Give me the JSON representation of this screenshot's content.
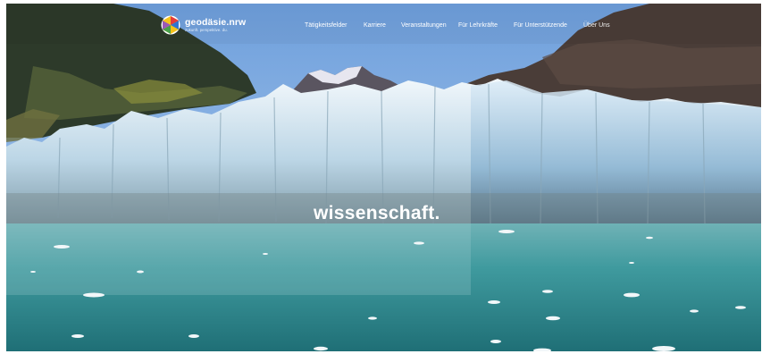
{
  "brand": {
    "name": "geodäsie.nrw",
    "tagline": "zukunft. perspektive. du."
  },
  "nav": {
    "items": [
      {
        "label": "Tätigkeitsfelder"
      },
      {
        "label": "Karriere"
      },
      {
        "label": "Veranstaltungen"
      },
      {
        "label": "Für Lehrkräfte"
      },
      {
        "label": "Für Unterstützende"
      },
      {
        "label": "Über Uns"
      }
    ]
  },
  "hero": {
    "title": "wissenschaft."
  },
  "colors": {
    "sky": "#8fb6e3",
    "glacier": "#dbe9f2",
    "water": "#2f8f93",
    "brand_accent": "#f4c21a"
  },
  "icons": {
    "logo": "globe-logo-icon"
  }
}
